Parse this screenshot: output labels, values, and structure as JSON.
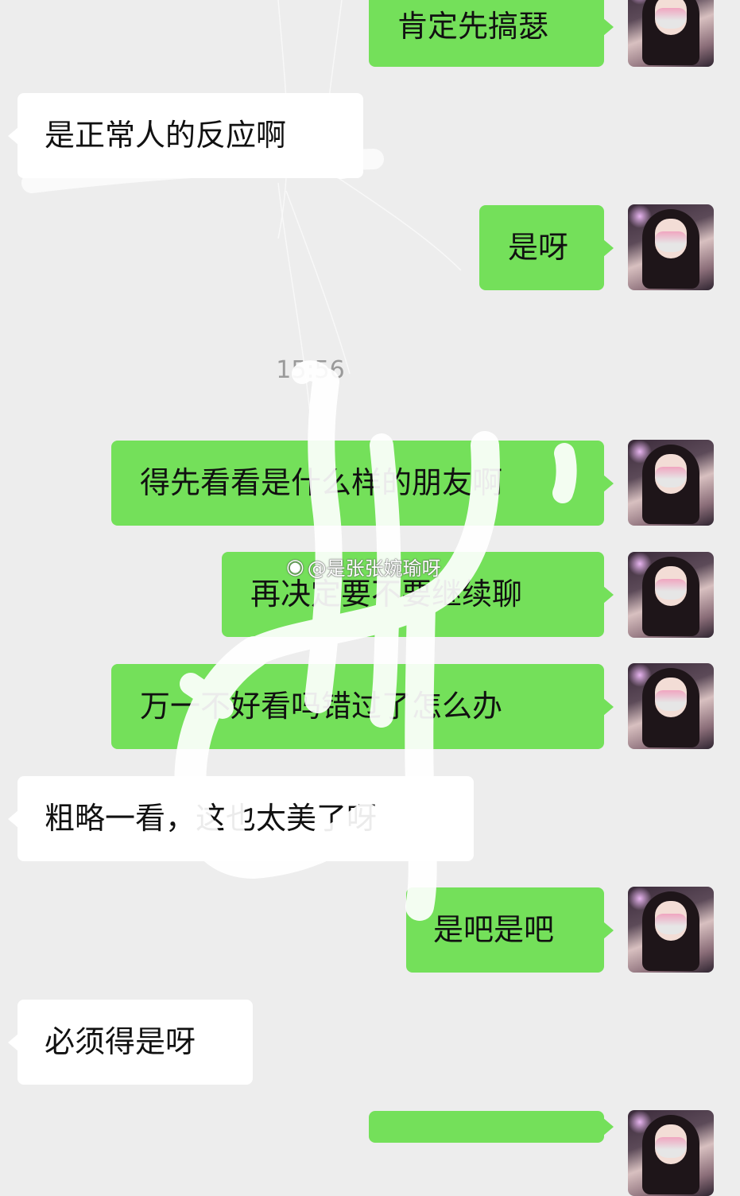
{
  "messages": [
    {
      "side": "mine",
      "text": "肯定先搞瑟"
    },
    {
      "side": "theirs",
      "text": "是正常人的反应啊"
    },
    {
      "side": "mine",
      "text": "是呀"
    },
    {
      "side": "mine",
      "text": "得先看看是什么样的朋友啊"
    },
    {
      "side": "mine",
      "text": "再决定要不要继续聊"
    },
    {
      "side": "mine",
      "text": "万一不好看吗错过了怎么办"
    },
    {
      "side": "theirs",
      "text": "粗略一看，这也太美了呀"
    },
    {
      "side": "mine",
      "text": "是吧是吧"
    },
    {
      "side": "theirs",
      "text": "必须得是呀"
    },
    {
      "side": "mine",
      "text": ""
    }
  ],
  "timestamp": "15:56",
  "watermark": {
    "icon": "weibo-icon",
    "text": "@是张张婉瑜呀"
  },
  "colors": {
    "background": "#ededed",
    "mine_bubble": "#74e05a",
    "theirs_bubble": "#ffffff",
    "timestamp": "#9a9a9a"
  }
}
